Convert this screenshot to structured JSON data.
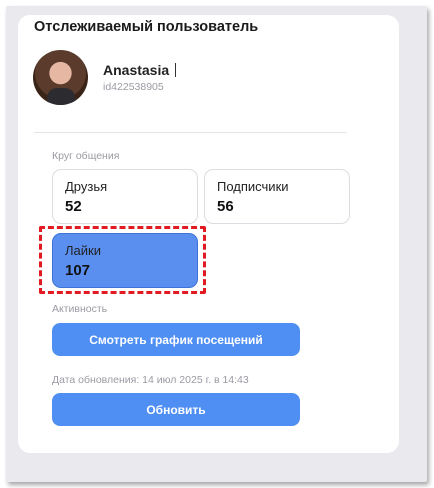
{
  "card": {
    "title": "Отслеживаемый пользователь"
  },
  "user": {
    "name": "Anastasia",
    "id": "id422538905"
  },
  "social": {
    "section_label": "Круг общения",
    "stats": [
      {
        "label": "Друзья",
        "value": "52"
      },
      {
        "label": "Подписчики",
        "value": "56"
      },
      {
        "label": "Лайки",
        "value": "107"
      }
    ]
  },
  "activity": {
    "section_label": "Активность",
    "view_button": "Смотреть график посещений"
  },
  "update": {
    "date_text": "Дата обновления: 14 июл 2025 г. в 14:43",
    "button": "Обновить"
  },
  "colors": {
    "accent": "#4f8ff4",
    "selected": "#5a8ff0",
    "highlight": "#e21b23"
  }
}
